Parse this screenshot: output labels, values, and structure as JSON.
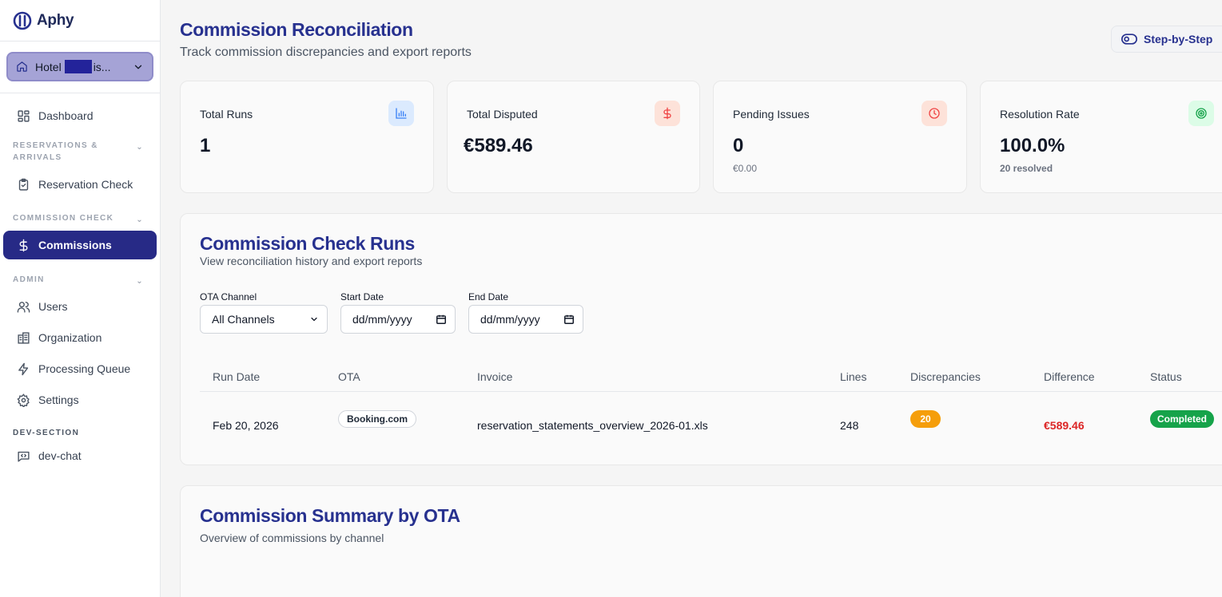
{
  "brand": {
    "name": "Aphy"
  },
  "hotel_selector": {
    "prefix": "Hotel",
    "suffix": "is..."
  },
  "sidebar": {
    "dashboard": "Dashboard",
    "section_reservations": "RESERVATIONS & ARRIVALS",
    "reservation_check": "Reservation Check",
    "section_commission": "COMMISSION CHECK",
    "commissions": "Commissions",
    "section_admin": "ADMIN",
    "users": "Users",
    "organization": "Organization",
    "processing_queue": "Processing Queue",
    "settings": "Settings",
    "section_dev": "DEV-SECTION",
    "dev_chat": "dev-chat"
  },
  "header": {
    "title": "Commission Reconciliation",
    "subtitle": "Track commission discrepancies and export reports",
    "step_button": "Step-by-Step"
  },
  "stats": [
    {
      "label": "Total Runs",
      "value": "1",
      "foot": "",
      "icon": "bar-chart-icon",
      "color": "#3b82f6"
    },
    {
      "label": "Total Disputed",
      "value": "€589.46",
      "foot": "",
      "icon": "dollar-icon",
      "color": "#ef4444"
    },
    {
      "label": "Pending Issues",
      "value": "0",
      "foot": "€0.00",
      "icon": "clock-icon",
      "color": "#ef4444"
    },
    {
      "label": "Resolution Rate",
      "value": "100.0%",
      "foot": "20 resolved",
      "icon": "target-icon",
      "color": "#16a34a"
    }
  ],
  "runs": {
    "title": "Commission Check Runs",
    "subtitle": "View reconciliation history and export reports",
    "filters": {
      "ota_label": "OTA Channel",
      "ota_value": "All Channels",
      "start_label": "Start Date",
      "start_placeholder": "dd/mm/yyyy",
      "end_label": "End Date",
      "end_placeholder": "dd/mm/yyyy"
    },
    "columns": [
      "Run Date",
      "OTA",
      "Invoice",
      "Lines",
      "Discrepancies",
      "Difference",
      "Status"
    ],
    "rows": [
      {
        "run_date": "Feb 20, 2026",
        "ota": "Booking.com",
        "invoice": "reservation_statements_overview_2026-01.xls",
        "lines": "248",
        "discrepancies": "20",
        "difference": "€589.46",
        "status": "Completed"
      }
    ]
  },
  "summary": {
    "title": "Commission Summary by OTA",
    "subtitle": "Overview of commissions by channel"
  }
}
